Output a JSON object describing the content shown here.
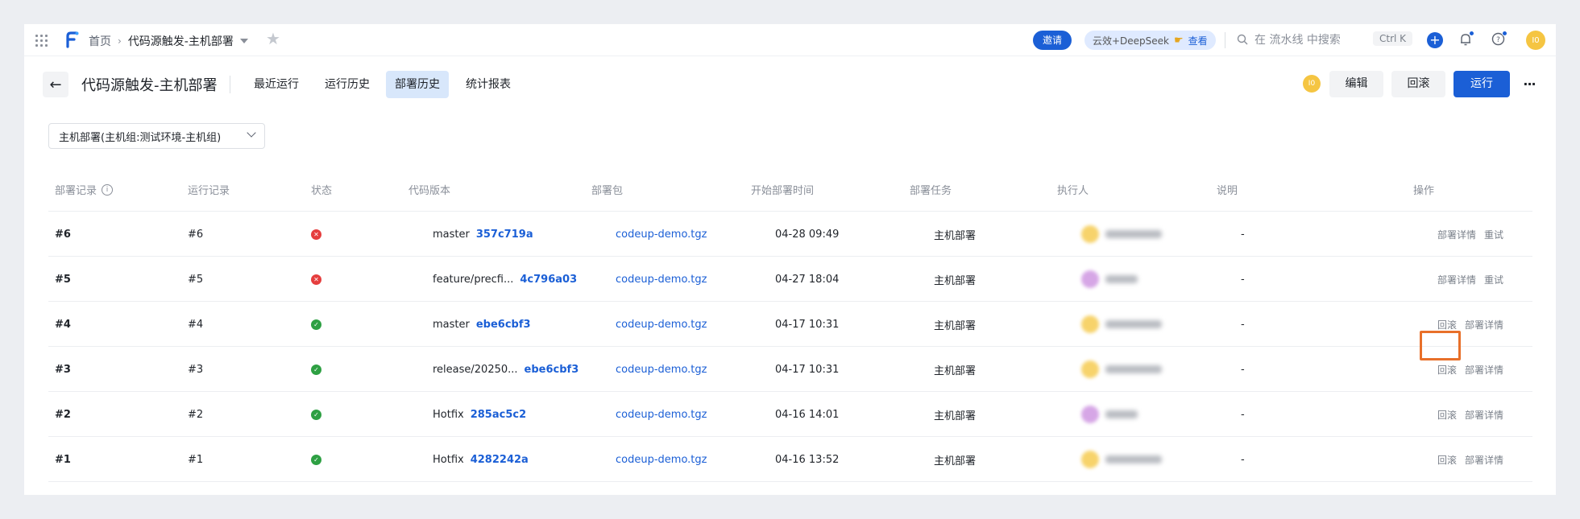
{
  "topbar": {
    "breadcrumb_home": "首页",
    "breadcrumb_current": "代码源触发-主机部署",
    "invite_label": "邀请",
    "promo_text": "云效+DeepSeek",
    "promo_link": "查看",
    "search_placeholder": "在 流水线 中搜索",
    "shortcut": "Ctrl K",
    "avatar_initials": "I0"
  },
  "header": {
    "title": "代码源触发-主机部署",
    "tabs": [
      {
        "label": "最近运行",
        "active": false
      },
      {
        "label": "运行历史",
        "active": false
      },
      {
        "label": "部署历史",
        "active": true
      },
      {
        "label": "统计报表",
        "active": false
      }
    ],
    "avatar_initials": "I0",
    "edit_label": "编辑",
    "rollback_label": "回滚",
    "run_label": "运行",
    "more_label": "···"
  },
  "env_select": {
    "value": "主机部署(主机组:测试环境-主机组)"
  },
  "table": {
    "columns": [
      "部署记录",
      "运行记录",
      "状态",
      "代码版本",
      "部署包",
      "开始部署时间",
      "部署任务",
      "执行人",
      "说明",
      "操作"
    ],
    "rows": [
      {
        "deploy": "#6",
        "run": "#6",
        "status": "fail",
        "branch": "master",
        "sha": "357c719a",
        "package": "codeup-demo.tgz",
        "time": "04-28 09:49",
        "task": "主机部署",
        "executor_color": "#f7d36b",
        "note": "-",
        "ops": [
          "部署详情",
          "重试"
        ]
      },
      {
        "deploy": "#5",
        "run": "#5",
        "status": "fail",
        "branch": "feature/precfi...",
        "sha": "4c796a03",
        "package": "codeup-demo.tgz",
        "time": "04-27 18:04",
        "task": "主机部署",
        "executor_color": "#d6a6e6",
        "note": "-",
        "ops": [
          "部署详情",
          "重试"
        ]
      },
      {
        "deploy": "#4",
        "run": "#4",
        "status": "ok",
        "branch": "master",
        "sha": "ebe6cbf3",
        "package": "codeup-demo.tgz",
        "time": "04-17 10:31",
        "task": "主机部署",
        "executor_color": "#f7d36b",
        "note": "-",
        "ops": [
          "回滚",
          "部署详情"
        ]
      },
      {
        "deploy": "#3",
        "run": "#3",
        "status": "ok",
        "branch": "release/20250...",
        "sha": "ebe6cbf3",
        "package": "codeup-demo.tgz",
        "time": "04-17 10:31",
        "task": "主机部署",
        "executor_color": "#f7d36b",
        "note": "-",
        "ops": [
          "回滚",
          "部署详情"
        ]
      },
      {
        "deploy": "#2",
        "run": "#2",
        "status": "ok",
        "branch": "Hotfix",
        "sha": "285ac5c2",
        "package": "codeup-demo.tgz",
        "time": "04-16 14:01",
        "task": "主机部署",
        "executor_color": "#d6a6e6",
        "note": "-",
        "ops": [
          "回滚",
          "部署详情"
        ]
      },
      {
        "deploy": "#1",
        "run": "#1",
        "status": "ok",
        "branch": "Hotfix",
        "sha": "4282242a",
        "package": "codeup-demo.tgz",
        "time": "04-16 13:52",
        "task": "主机部署",
        "executor_color": "#f7d36b",
        "note": "-",
        "ops": [
          "回滚",
          "部署详情"
        ]
      }
    ]
  },
  "colors": {
    "accent": "#1b5fd6",
    "fail": "#e53e3e",
    "success": "#2ea043",
    "highlight": "#e8702a"
  }
}
